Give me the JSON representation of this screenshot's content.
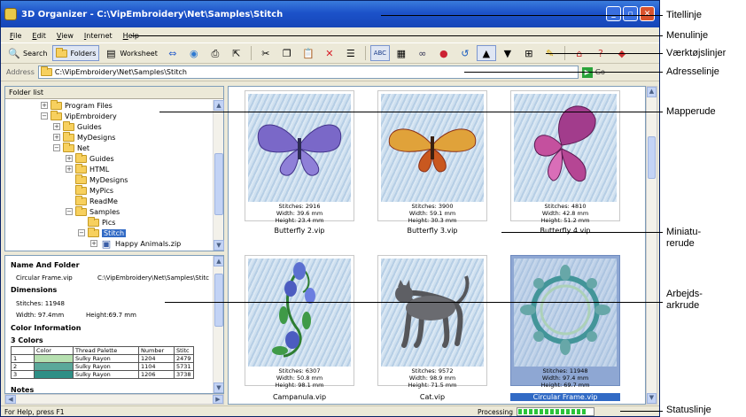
{
  "window": {
    "title": "3D Organizer - C:\\VipEmbroidery\\Net\\Samples\\Stitch"
  },
  "menu": [
    "File",
    "Edit",
    "View",
    "Internet",
    "Help"
  ],
  "toolbar": {
    "search": "Search",
    "folders": "Folders",
    "worksheet": "Worksheet"
  },
  "address": {
    "label": "Address",
    "value": "C:\\VipEmbroidery\\Net\\Samples\\Stitch",
    "go": "Go"
  },
  "folder_list": {
    "header": "Folder list",
    "items": [
      "Program Files",
      "VipEmbroidery",
      "Guides",
      "MyDesigns",
      "Net",
      "Guides",
      "HTML",
      "MyDesigns",
      "MyPics",
      "ReadMe",
      "Samples",
      "Pics",
      "Stitch",
      "Happy Animals.zip"
    ]
  },
  "worksheet": {
    "section_name": "Name And Folder",
    "file": "Circular Frame.vip",
    "folder": "C:\\VipEmbroidery\\Net\\Samples\\Stitc",
    "section_dims": "Dimensions",
    "stitches": "Stitches: 11948",
    "width": "Width: 97.4mm",
    "height": "Height:69.7 mm",
    "section_color": "Color Information",
    "colors_title": "3 Colors",
    "headers": [
      "",
      "Color",
      "Thread Palette",
      "Number",
      "Stitc"
    ],
    "rows": [
      {
        "n": "1",
        "color": "#b6e0b0",
        "palette": "Sulky Rayon",
        "number": "1204",
        "stitches": "2479"
      },
      {
        "n": "2",
        "color": "#5aa89a",
        "palette": "Sulky Rayon",
        "number": "1104",
        "stitches": "5731"
      },
      {
        "n": "3",
        "color": "#2e8f86",
        "palette": "Sulky Rayon",
        "number": "1206",
        "stitches": "3738"
      }
    ],
    "notes": "Notes"
  },
  "thumbnails": [
    {
      "name": "Butterfly 2.vip",
      "stitches": "Stitches: 2916",
      "width": "Width: 39.6 mm",
      "height": "Height: 23.4 mm"
    },
    {
      "name": "Butterfly 3.vip",
      "stitches": "Stitches: 3900",
      "width": "Width: 59.1 mm",
      "height": "Height: 30.3 mm"
    },
    {
      "name": "Butterfly 4.vip",
      "stitches": "Stitches: 4810",
      "width": "Width: 42.8 mm",
      "height": "Height: 51.2 mm"
    },
    {
      "name": "Campanula.vip",
      "stitches": "Stitches: 6307",
      "width": "Width: 50.8 mm",
      "height": "Height: 98.1 mm"
    },
    {
      "name": "Cat.vip",
      "stitches": "Stitches: 9572",
      "width": "Width: 98.9 mm",
      "height": "Height: 71.5 mm"
    },
    {
      "name": "Circular Frame.vip",
      "stitches": "Stitches: 11948",
      "width": "Width: 97.4 mm",
      "height": "Height: 69.7 mm"
    }
  ],
  "status": {
    "help": "For Help, press F1",
    "processing": "Processing",
    "progress": 0.92
  },
  "callouts": [
    "Titellinje",
    "Menulinje",
    "Værktøjslinjer",
    "Adresselinje",
    "Mapperude",
    "Miniatu-\nrerude",
    "Arbejds-\narkrude",
    "Statuslinje"
  ]
}
